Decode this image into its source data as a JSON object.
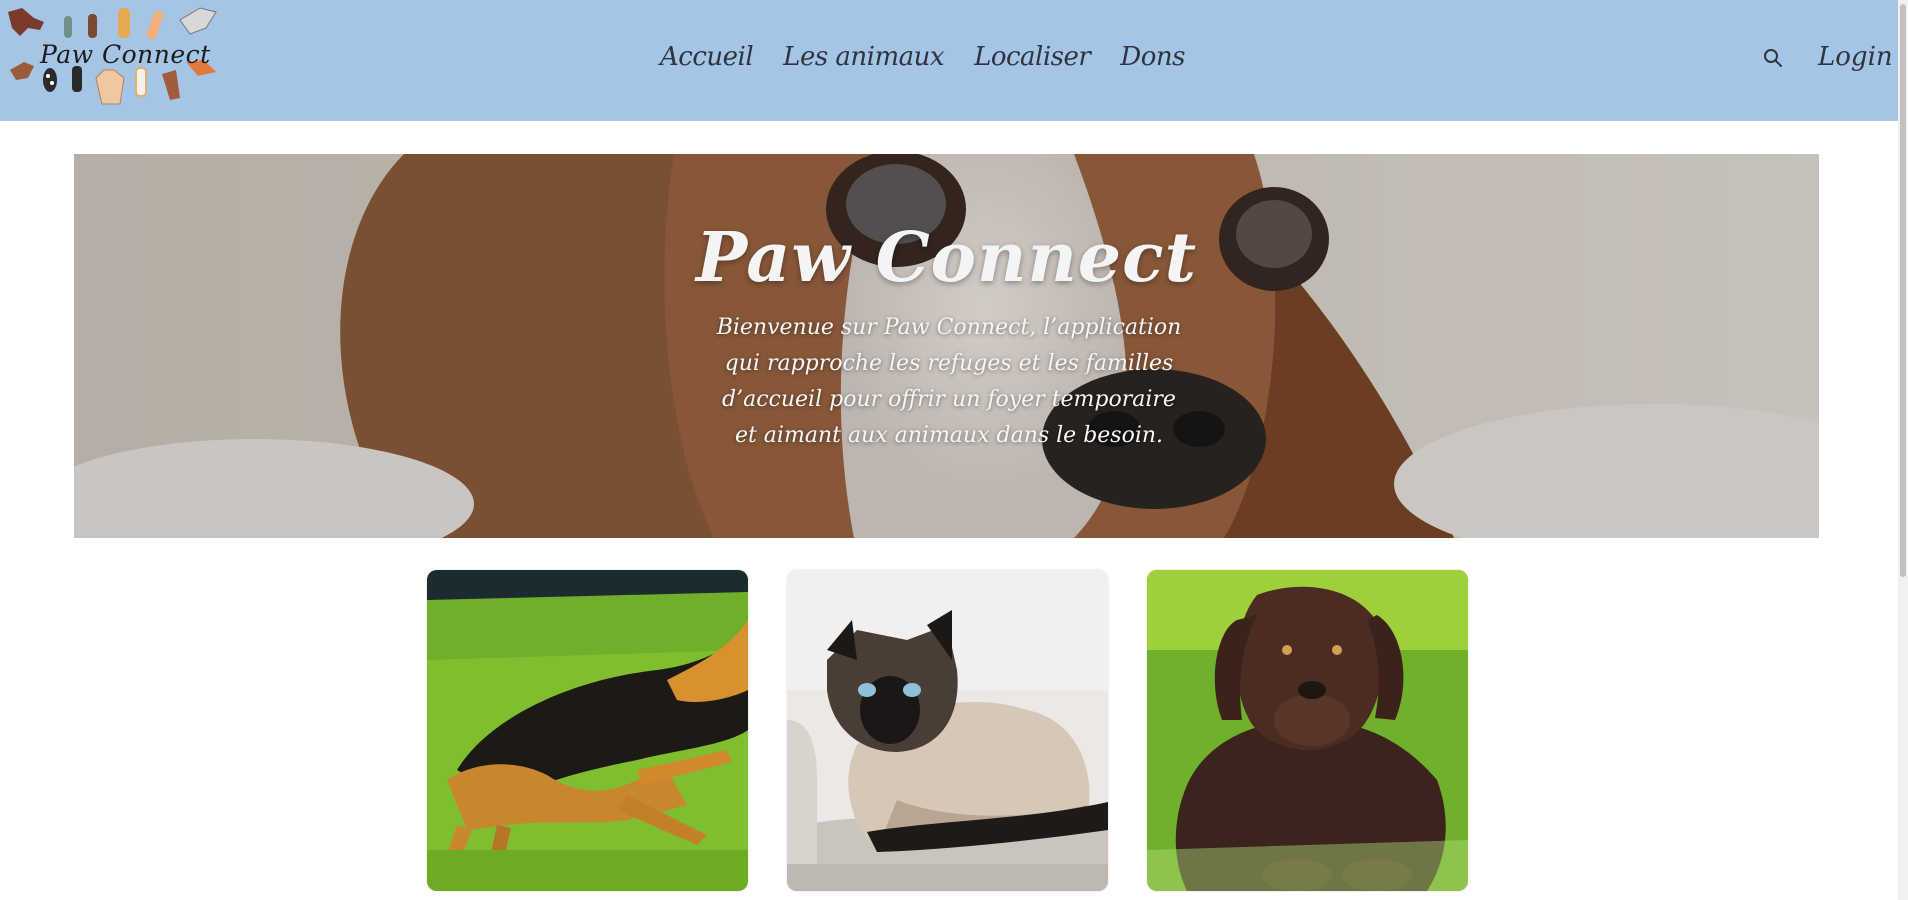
{
  "header": {
    "logo_text": "Paw Connect",
    "nav": [
      "Accueil",
      "Les animaux",
      "Localiser",
      "Dons"
    ],
    "search_icon": "search-icon",
    "login_label": "Login"
  },
  "hero": {
    "title": "Paw Connect",
    "text": "Bienvenue sur Paw Connect, l’application qui rapproche les refuges et les familles d’accueil pour offrir un foyer temporaire et aimant aux animaux dans le besoin."
  },
  "cards": [
    {
      "image": "german-shepherd-running"
    },
    {
      "image": "siamese-cat"
    },
    {
      "image": "chocolate-labrador"
    }
  ],
  "colors": {
    "header_bg": "#a4c5e6",
    "nav_text": "#2f3440",
    "hero_text": "#f4f4f4"
  }
}
